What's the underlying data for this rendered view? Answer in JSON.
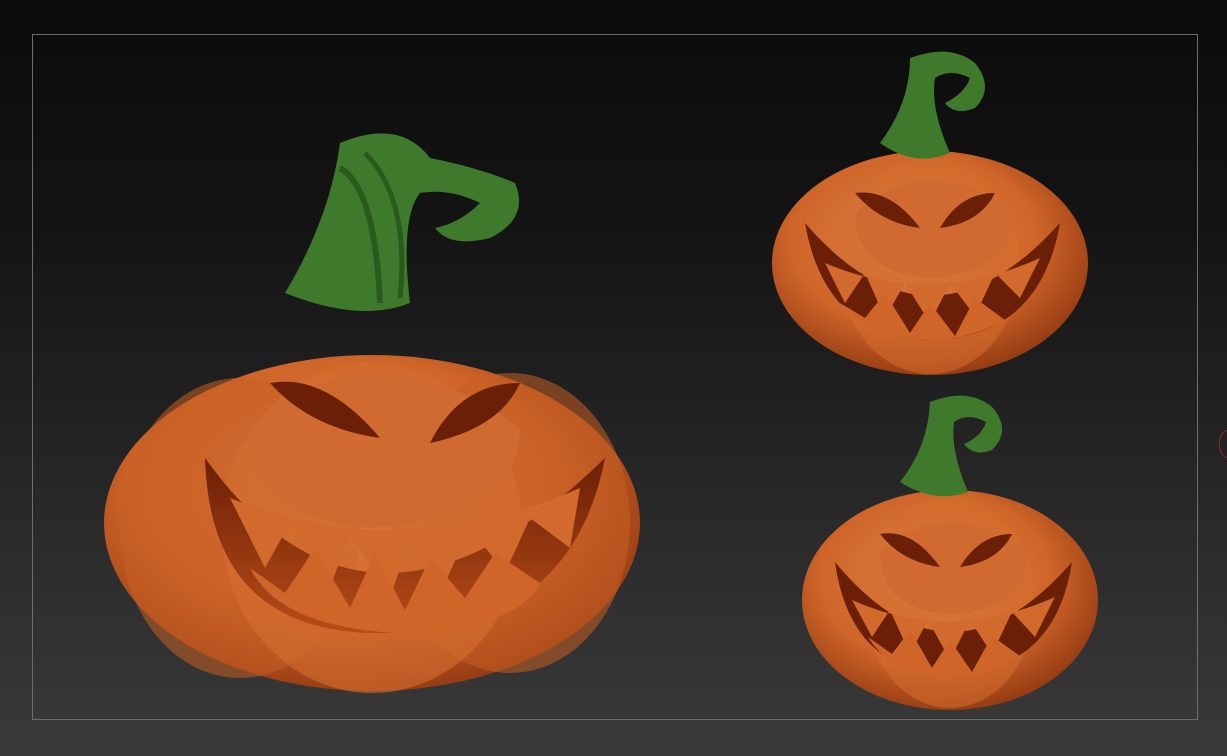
{
  "canvas": {
    "background_top": "#0b0b0b",
    "background_bottom": "#3a3a3a",
    "frame_color": "#6e6e6e"
  },
  "colors": {
    "pumpkin_body": "#d2692e",
    "pumpkin_highlight": "#e0824a",
    "pumpkin_shadow": "#8c3510",
    "cavity": "#7a2608",
    "cavity_light": "#c85a22",
    "stem": "#3f7a2c",
    "stem_dark": "#2a5a1c"
  },
  "models": [
    {
      "name": "large-pumpkin",
      "view": "three-quarter"
    },
    {
      "name": "small-pumpkin-top",
      "view": "front"
    },
    {
      "name": "small-pumpkin-bottom",
      "view": "front"
    }
  ]
}
